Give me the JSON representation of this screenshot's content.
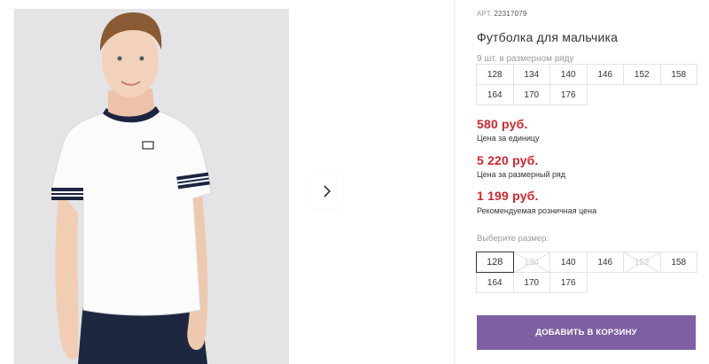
{
  "product": {
    "article_label": "АРТ.",
    "article_number": "22317079",
    "title": "Футболка для мальчика",
    "size_row_note": "9 шт. в размерном ряду"
  },
  "size_row": [
    "128",
    "134",
    "140",
    "146",
    "152",
    "158",
    "164",
    "170",
    "176"
  ],
  "prices": [
    {
      "value": "580 руб.",
      "label": "Цена за единицу"
    },
    {
      "value": "5 220 руб.",
      "label": "Цена за размерный ряд"
    },
    {
      "value": "1 199 руб.",
      "label": "Рекомендуемая розничная цена"
    }
  ],
  "size_select": {
    "label": "Выберите размер:",
    "options": [
      {
        "size": "128",
        "state": "selected"
      },
      {
        "size": "134",
        "state": "unavailable"
      },
      {
        "size": "140",
        "state": "available"
      },
      {
        "size": "146",
        "state": "available"
      },
      {
        "size": "152",
        "state": "unavailable"
      },
      {
        "size": "158",
        "state": "available"
      },
      {
        "size": "164",
        "state": "available"
      },
      {
        "size": "170",
        "state": "available"
      },
      {
        "size": "176",
        "state": "available"
      }
    ]
  },
  "cart_button": "ДОБАВИТЬ В КОРЗИНУ",
  "gallery": {
    "next_icon": "chevron-right-icon"
  },
  "colors": {
    "price": "#d0262f",
    "button": "#7d5fa2",
    "photo_bg": "#e4e4e6"
  }
}
